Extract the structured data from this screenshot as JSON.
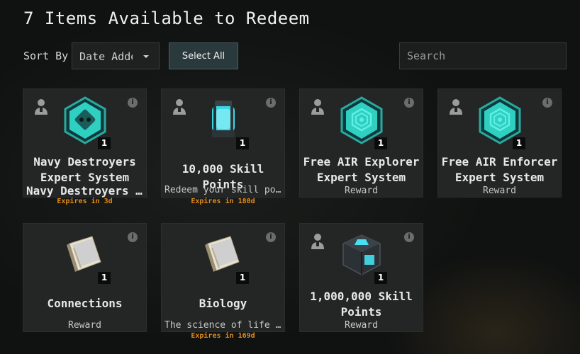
{
  "header": {
    "title": "7 Items Available to Redeem",
    "sort_label": "Sort By",
    "sort_value": "Date Added",
    "select_all_label": "Select All",
    "search_placeholder": "Search"
  },
  "items": [
    {
      "name": "Navy Destroyers\nExpert System",
      "desc": "Navy Destroyers ...",
      "expires": "Expires in 3d",
      "qty": "1",
      "icon": "expert-system-badge-icon"
    },
    {
      "name": "10,000 Skill Points",
      "desc": "Redeem your skill poin...",
      "expires": "Expires in 180d",
      "qty": "1",
      "icon": "skill-injector-icon"
    },
    {
      "name": "Free AIR Explorer\nExpert System",
      "desc": "Reward",
      "expires": "",
      "qty": "1",
      "icon": "expert-system-badge-icon"
    },
    {
      "name": "Free AIR Enforcer\nExpert System",
      "desc": "Reward",
      "expires": "",
      "qty": "1",
      "icon": "expert-system-badge-icon"
    },
    {
      "name": "Connections",
      "desc": "Reward",
      "expires": "",
      "qty": "1",
      "icon": "skillbook-icon"
    },
    {
      "name": "Biology",
      "desc": "The science of life and...",
      "expires": "Expires in 169d",
      "qty": "1",
      "icon": "skillbook-icon"
    },
    {
      "name": "1,000,000 Skill\nPoints",
      "desc": "Reward",
      "expires": "",
      "qty": "1",
      "icon": "skill-crate-icon"
    }
  ],
  "colors": {
    "accent": "#39d3c8",
    "expires": "#e08a1a"
  }
}
